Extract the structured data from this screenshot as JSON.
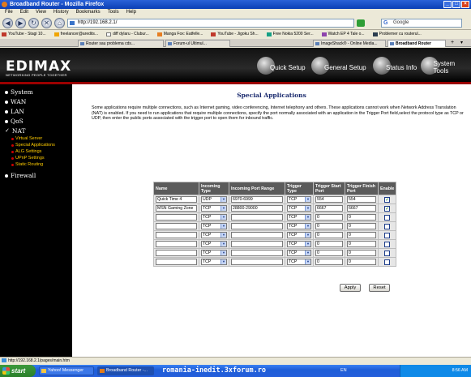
{
  "browser": {
    "window_title": "Broadband Router - Mozilla Firefox",
    "menu": [
      "File",
      "Edit",
      "View",
      "History",
      "Bookmarks",
      "Tools",
      "Help"
    ],
    "url": "http://192.168.2.1/",
    "search_placeholder": "Google",
    "bookmarks": [
      "YouTube - Stagi 10...",
      "freelancer@aredits...",
      "diff dylaru - Clubur...",
      "Manga Fox: Eatfelle...",
      "YouTube - Jigoku Sh...",
      "Free Nokia 5200 Ser...",
      "Watch EP 4 Tale o...",
      "Problemer cu routerul..."
    ],
    "tabs": [
      {
        "label": "Router sau problema cds...",
        "active": false
      },
      {
        "label": "Forum-ul Ultimul...",
        "active": false
      },
      {
        "label": "ImageShack® - Online Media...",
        "active": false
      },
      {
        "label": "Broadband Router",
        "active": true
      }
    ],
    "status_text": "http://192.168.2.1/pages/main.htm"
  },
  "router": {
    "logo": "EDIMAX",
    "tagline": "NETWORKING PEOPLE TOGETHER",
    "top_nav": [
      "Quick Setup",
      "General Setup",
      "Status Info",
      "System Tools"
    ],
    "sidebar": [
      {
        "label": "System",
        "type": "main"
      },
      {
        "label": "WAN",
        "type": "main"
      },
      {
        "label": "LAN",
        "type": "main"
      },
      {
        "label": "QoS",
        "type": "main"
      },
      {
        "label": "NAT",
        "type": "main-open"
      },
      {
        "label": "Virtual Server",
        "type": "sub"
      },
      {
        "label": "Special Applications",
        "type": "sub"
      },
      {
        "label": "ALG Settings",
        "type": "sub"
      },
      {
        "label": "UPnP Settings",
        "type": "sub"
      },
      {
        "label": "Static Routing",
        "type": "sub"
      },
      {
        "label": "Firewall",
        "type": "main"
      }
    ],
    "page_title": "Special Applications",
    "description": "Some applications require multiple connections, such as Internet gaming, video conferencing, Internet telephony and others. These applications cannot work when Network Address Translation (NAT) is enabled. If you need to run applications that require multiple connections, specify the port normally associated with an application in the Trigger Port field,select the protocol type as TCP or UDP, then enter the public ports associated with the trigger port to open them for inbound traffic.",
    "table": {
      "headers": [
        "Name",
        "Incoming Type",
        "Incoming Port Range",
        "Trigger Type",
        "Trigger Start Port",
        "Trigger Finish Port",
        "Enable"
      ],
      "rows": [
        {
          "name": "Quick Time 4",
          "in_type": "UDP",
          "in_range": "6970-6999",
          "trig_type": "TCP",
          "start": "554",
          "finish": "554",
          "enable": true
        },
        {
          "name": "MSN Gaming Zone",
          "in_type": "TCP",
          "in_range": "28800-29000",
          "trig_type": "TCP",
          "start": "6667",
          "finish": "6667",
          "enable": true
        },
        {
          "name": "",
          "in_type": "TCP",
          "in_range": "",
          "trig_type": "TCP",
          "start": "0",
          "finish": "0",
          "enable": false
        },
        {
          "name": "",
          "in_type": "TCP",
          "in_range": "",
          "trig_type": "TCP",
          "start": "0",
          "finish": "0",
          "enable": false
        },
        {
          "name": "",
          "in_type": "TCP",
          "in_range": "",
          "trig_type": "TCP",
          "start": "0",
          "finish": "0",
          "enable": false
        },
        {
          "name": "",
          "in_type": "TCP",
          "in_range": "",
          "trig_type": "TCP",
          "start": "0",
          "finish": "0",
          "enable": false
        },
        {
          "name": "",
          "in_type": "TCP",
          "in_range": "",
          "trig_type": "TCP",
          "start": "0",
          "finish": "0",
          "enable": false
        },
        {
          "name": "",
          "in_type": "TCP",
          "in_range": "",
          "trig_type": "TCP",
          "start": "0",
          "finish": "0",
          "enable": false
        }
      ]
    },
    "apply_label": "Apply",
    "reset_label": "Reset"
  },
  "taskbar": {
    "start_label": "start",
    "buttons": [
      {
        "label": "Yahoo! Messenger",
        "active": false
      },
      {
        "label": "Broadband Router -...",
        "active": true
      }
    ],
    "watermark": "romania-inedit.3xforum.ro",
    "language": "EN",
    "clock": "8:56 AM"
  },
  "colors": {
    "sidebar_bg": "#000000",
    "header_red": "#9b0000",
    "subnav_yellow": "#ffcc00",
    "table_header": "#5b5b5b",
    "title_blue": "#1a2a6e"
  }
}
